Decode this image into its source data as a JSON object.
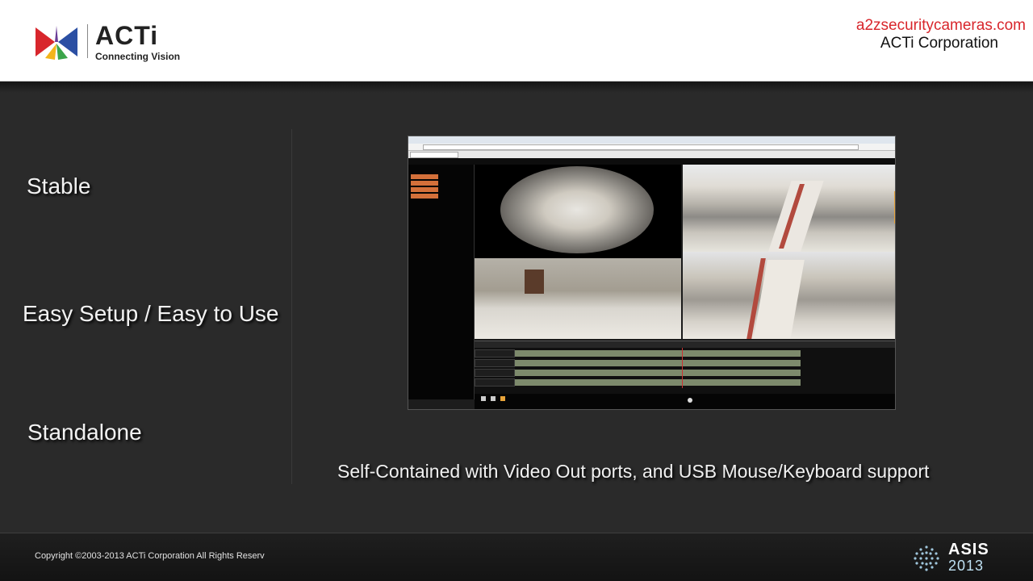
{
  "header": {
    "logo_word": "ACTi",
    "logo_tagline": "Connecting Vision",
    "site_url": "a2zsecuritycameras.com",
    "company": "ACTi Corporation",
    "url_color": "#d8262c"
  },
  "features": {
    "item1": "Stable",
    "item2": "Easy Setup / Easy to Use",
    "item3": "Standalone"
  },
  "caption": "Self-Contained with Video Out ports, and USB Mouse/Keyboard support",
  "footer": {
    "copyright": "Copyright ©2003-2013  ACTi Corporation All Rights Reserv",
    "event_name": "ASIS",
    "event_year": "2013"
  },
  "icons": {
    "logo": "acti-logo-icon",
    "event": "asis-dots-icon"
  }
}
